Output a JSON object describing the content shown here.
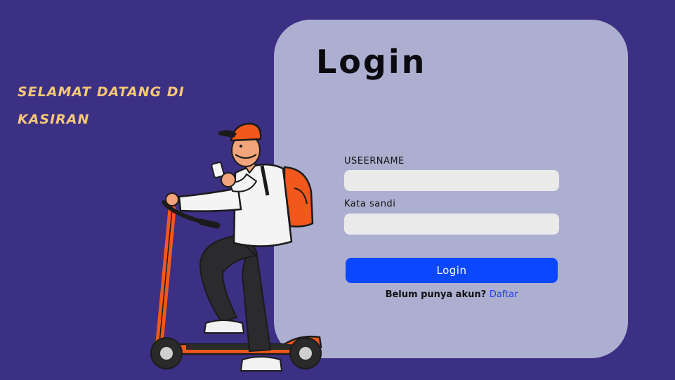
{
  "welcome": {
    "line1": "SELAMAT DATANG DI",
    "line2": "KASIRAN"
  },
  "form": {
    "title": "Login",
    "username_label": "USEERNAME",
    "username_value": "",
    "password_label": "Kata sandi",
    "password_value": "",
    "submit_label": "Login",
    "register_prompt": "Belum punya akun?",
    "register_link": "Daftar"
  },
  "colors": {
    "background": "#3c3084",
    "card": "#adafd1",
    "accent": "#0b47ff",
    "welcome_text": "#f6c877",
    "scooter": "#f2581c"
  },
  "illustration": {
    "icon": "scooter-rider-illustration"
  }
}
